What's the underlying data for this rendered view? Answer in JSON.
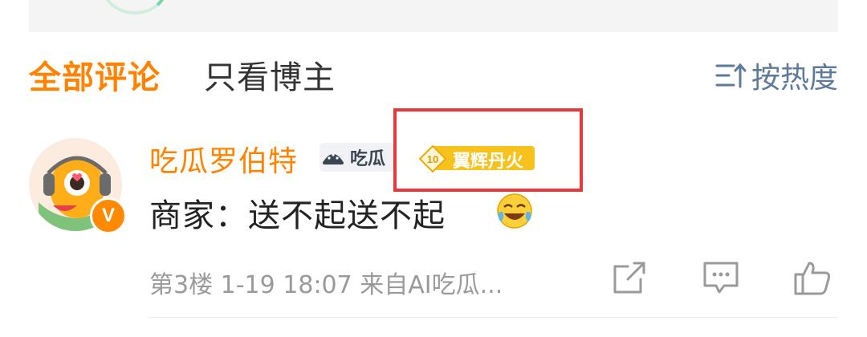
{
  "tabs": {
    "all_comments": "全部评论",
    "only_host": "只看博主",
    "sort_label": "按热度",
    "sort_icon": "sort-hot-icon"
  },
  "comment": {
    "username": "吃瓜罗伯特",
    "fan_badge_label": "吃瓜",
    "level_badge": {
      "level": "10",
      "title": "翼辉丹火"
    },
    "text": "商家：送不起送不起",
    "emoji": "laugh-cry-emoji",
    "floor": "第3楼",
    "time": "1-19 18:07",
    "source": "来自AI吃瓜...",
    "verified": "V"
  },
  "colors": {
    "accent": "#ff8200",
    "sort_blue": "#5d7a9a",
    "badge_yellow": "#f8c21c",
    "highlight_red": "#e8373b"
  }
}
